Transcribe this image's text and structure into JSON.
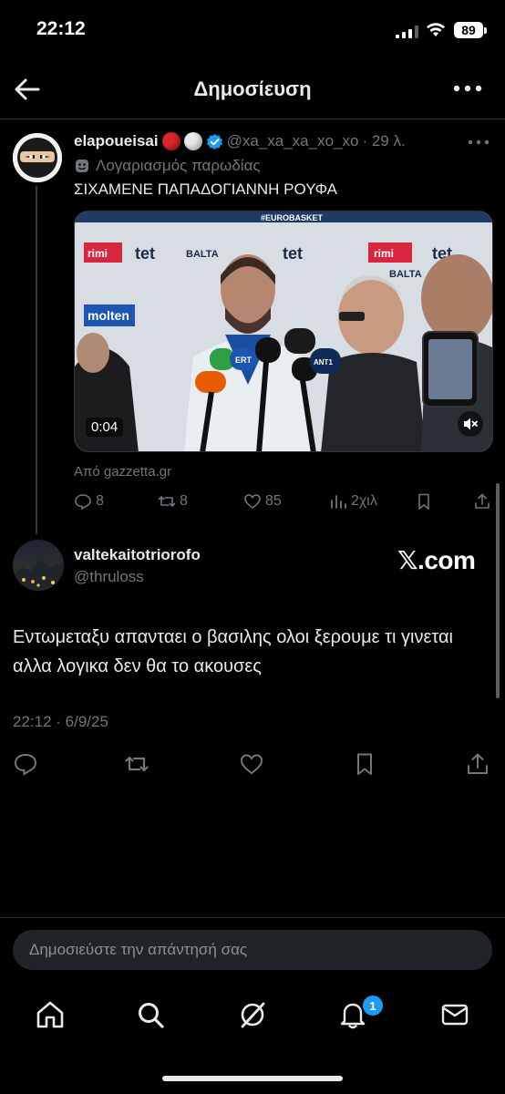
{
  "status_bar": {
    "time": "22:12",
    "battery": "89"
  },
  "header": {
    "title": "Δημοσίευση"
  },
  "quoted_tweet": {
    "name": "elapoueisai",
    "handle": "@xa_xa_xa_xo_xo",
    "age": "· 29 λ.",
    "parody_label": "Λογαριασμός παρωδίας",
    "text": "ΣΙΧΑΜΕΝΕ ΠΑΠΑΔΟΓΙΑΝΝΗ ΡΟΥΦΑ",
    "video_duration": "0:04",
    "source": "Από gazzetta.gr",
    "replies": "8",
    "retweets": "8",
    "likes": "85",
    "views": "2χιλ",
    "backdrop": {
      "row_a": [
        "#EUROBASKET",
        "molten",
        "tet",
        "BALTA",
        "rimi"
      ],
      "row_b": [
        "tet",
        "rimi",
        "tet",
        "BALTA",
        "molten"
      ],
      "mic_brands": [
        "ERT",
        "SPORT 24",
        "ANT1"
      ]
    }
  },
  "main_tweet": {
    "name": "valtekaitotriorofo",
    "handle": "@thruloss",
    "watermark": "𝕏.com",
    "text": "Εντωμεταξυ απανταει ο βασιλης ολοι ξερουμε τι γινεται αλλα λογικα δεν θα το ακουσες",
    "timestamp": "22:12 · 6/9/25"
  },
  "reply": {
    "placeholder": "Δημοσιεύστε την απάντησή σας"
  },
  "nav": {
    "notification_count": "1"
  },
  "colors": {
    "background": "#000000",
    "accent": "#1d9bf0",
    "muted": "#71767b",
    "text": "#e7e9ea"
  }
}
